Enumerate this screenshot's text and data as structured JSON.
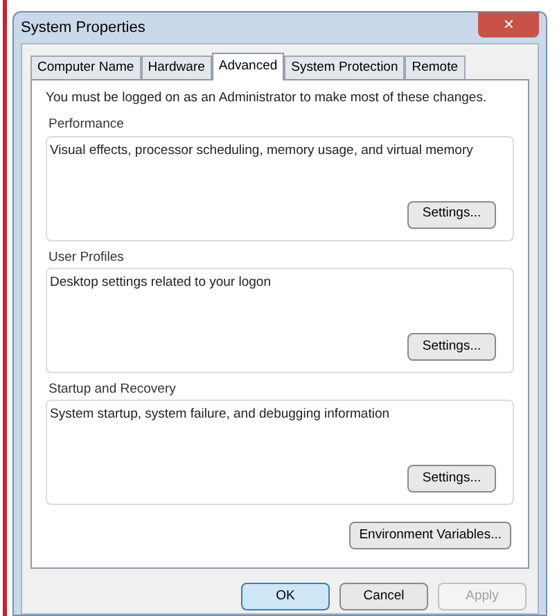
{
  "window": {
    "title": "System Properties",
    "close": "✕"
  },
  "tabs": [
    {
      "label": "Computer Name",
      "selected": false
    },
    {
      "label": "Hardware",
      "selected": false
    },
    {
      "label": "Advanced",
      "selected": true
    },
    {
      "label": "System Protection",
      "selected": false
    },
    {
      "label": "Remote",
      "selected": false
    }
  ],
  "notice": "You must be logged on as an Administrator to make most of these changes.",
  "groups": [
    {
      "title": "Performance",
      "description": "Visual effects, processor scheduling, memory usage, and virtual memory",
      "button": "Settings..."
    },
    {
      "title": "User Profiles",
      "description": "Desktop settings related to your logon",
      "button": "Settings..."
    },
    {
      "title": "Startup and Recovery",
      "description": "System startup, system failure, and debugging information",
      "button": "Settings..."
    }
  ],
  "env_button": "Environment Variables...",
  "buttons": [
    {
      "label": "OK",
      "disabled": false,
      "default": true
    },
    {
      "label": "Cancel",
      "disabled": false,
      "default": false
    },
    {
      "label": "Apply",
      "disabled": true,
      "default": false
    }
  ]
}
